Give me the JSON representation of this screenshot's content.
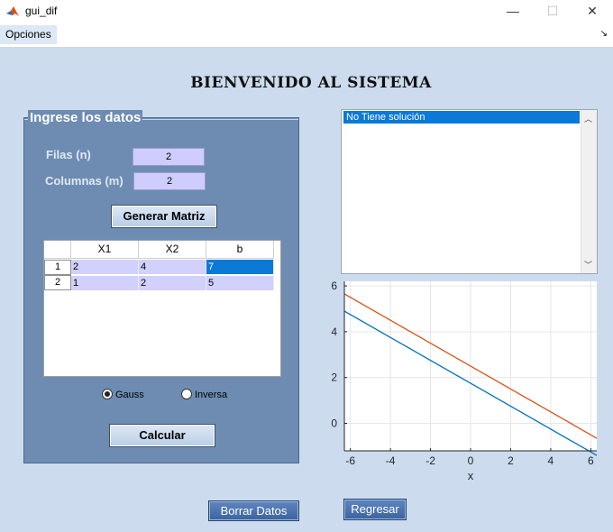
{
  "window": {
    "title": "gui_dif",
    "minimize": "—",
    "maximize": "☐",
    "close": "✕"
  },
  "menu": {
    "opciones": "Opciones",
    "corner_arrow": "↘"
  },
  "header": {
    "title": "BIENVENIDO AL SISTEMA"
  },
  "panel": {
    "title": "Ingrese los datos",
    "filas_label": "Filas (n)",
    "filas_value": "2",
    "columnas_label": "Columnas (m)",
    "columnas_value": "2",
    "generar_button": "Generar Matriz",
    "calcular_button": "Calcular"
  },
  "table": {
    "columns": [
      "X1",
      "X2",
      "b"
    ],
    "row_headers": [
      "1",
      "2"
    ],
    "rows": [
      [
        "2",
        "4",
        "7"
      ],
      [
        "1",
        "2",
        "5"
      ]
    ]
  },
  "method": {
    "options": [
      "Gauss",
      "Inversa"
    ],
    "selected": "Gauss"
  },
  "result_list": {
    "items": [
      "No Tiene solución"
    ]
  },
  "chart_data": {
    "type": "line",
    "xlabel": "x",
    "ylabel": "",
    "xlim": [
      -6.3,
      6.3
    ],
    "ylim": [
      -1.2,
      6.2
    ],
    "x_ticks": [
      -6,
      -4,
      -2,
      0,
      2,
      4,
      6
    ],
    "y_ticks": [
      0,
      2,
      4,
      6
    ],
    "grid": true,
    "series": [
      {
        "color": "#0072bd",
        "x": [
          -6.3,
          6.3
        ],
        "y": [
          4.9,
          -1.4
        ]
      },
      {
        "color": "#d95319",
        "x": [
          -6.3,
          6.3
        ],
        "y": [
          5.65,
          -0.65
        ]
      }
    ]
  },
  "footer": {
    "borrar_button": "Borrar Datos",
    "regresar_button": "Regresar"
  }
}
